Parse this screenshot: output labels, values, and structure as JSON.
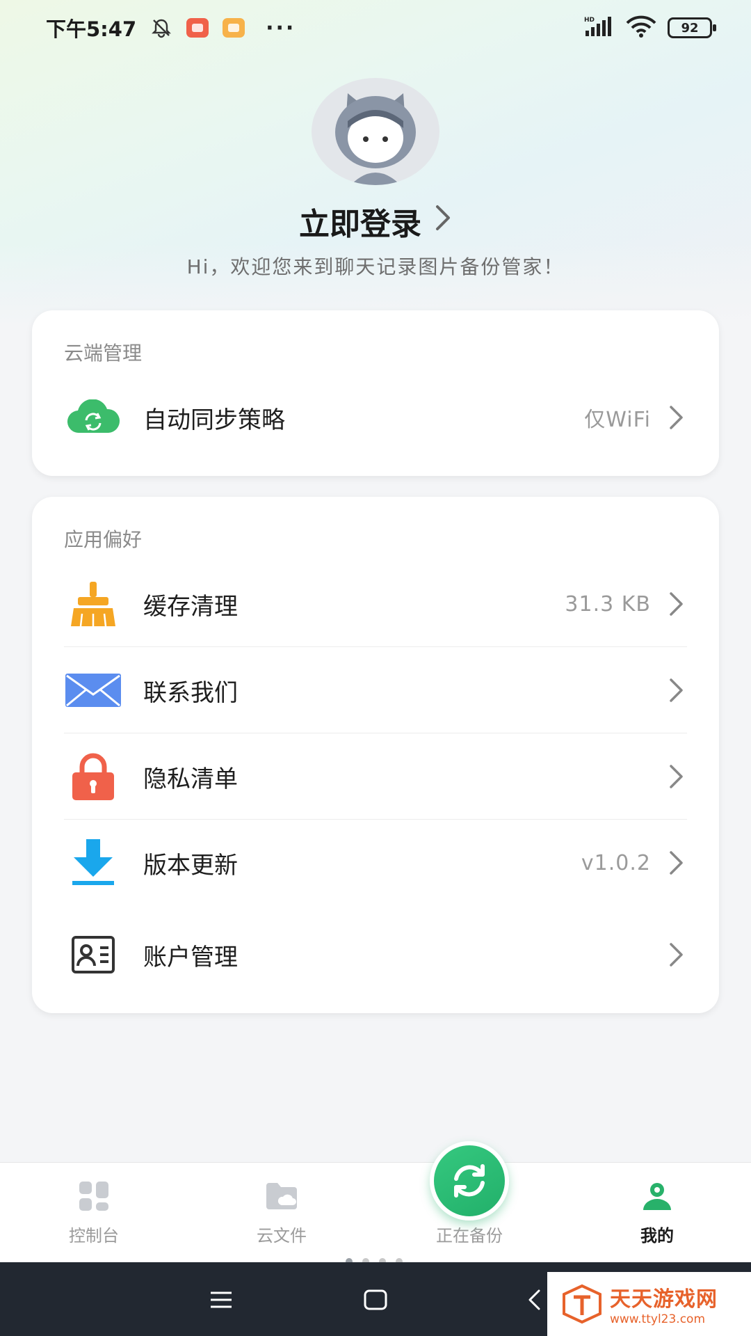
{
  "status_bar": {
    "time": "下午5:47",
    "network": "HD",
    "battery": "92"
  },
  "profile": {
    "login_label": "立即登录",
    "welcome": "Hi，欢迎您来到聊天记录图片备份管家！"
  },
  "cloud_section": {
    "title": "云端管理",
    "items": [
      {
        "label": "自动同步策略",
        "value": "仅WiFi",
        "icon": "cloud-sync-icon"
      }
    ]
  },
  "prefs_section": {
    "title": "应用偏好",
    "items": [
      {
        "label": "缓存清理",
        "value": "31.3 KB",
        "icon": "broom-icon"
      },
      {
        "label": "联系我们",
        "value": "",
        "icon": "mail-icon"
      },
      {
        "label": "隐私清单",
        "value": "",
        "icon": "lock-icon"
      },
      {
        "label": "版本更新",
        "value": "v1.0.2",
        "icon": "download-icon"
      },
      {
        "label": "账户管理",
        "value": "",
        "icon": "id-card-icon"
      }
    ]
  },
  "bottom_nav": {
    "items": [
      {
        "label": "控制台",
        "active": false
      },
      {
        "label": "云文件",
        "active": false
      },
      {
        "label": "正在备份",
        "active": false
      },
      {
        "label": "我的",
        "active": true
      }
    ]
  },
  "watermark": {
    "title": "天天游戏网",
    "url": "www.ttyl23.com"
  },
  "colors": {
    "accent_green": "#22b06a",
    "orange": "#f5a623",
    "blue": "#5b8def",
    "red": "#f0614a",
    "sky": "#1aa7ec"
  }
}
